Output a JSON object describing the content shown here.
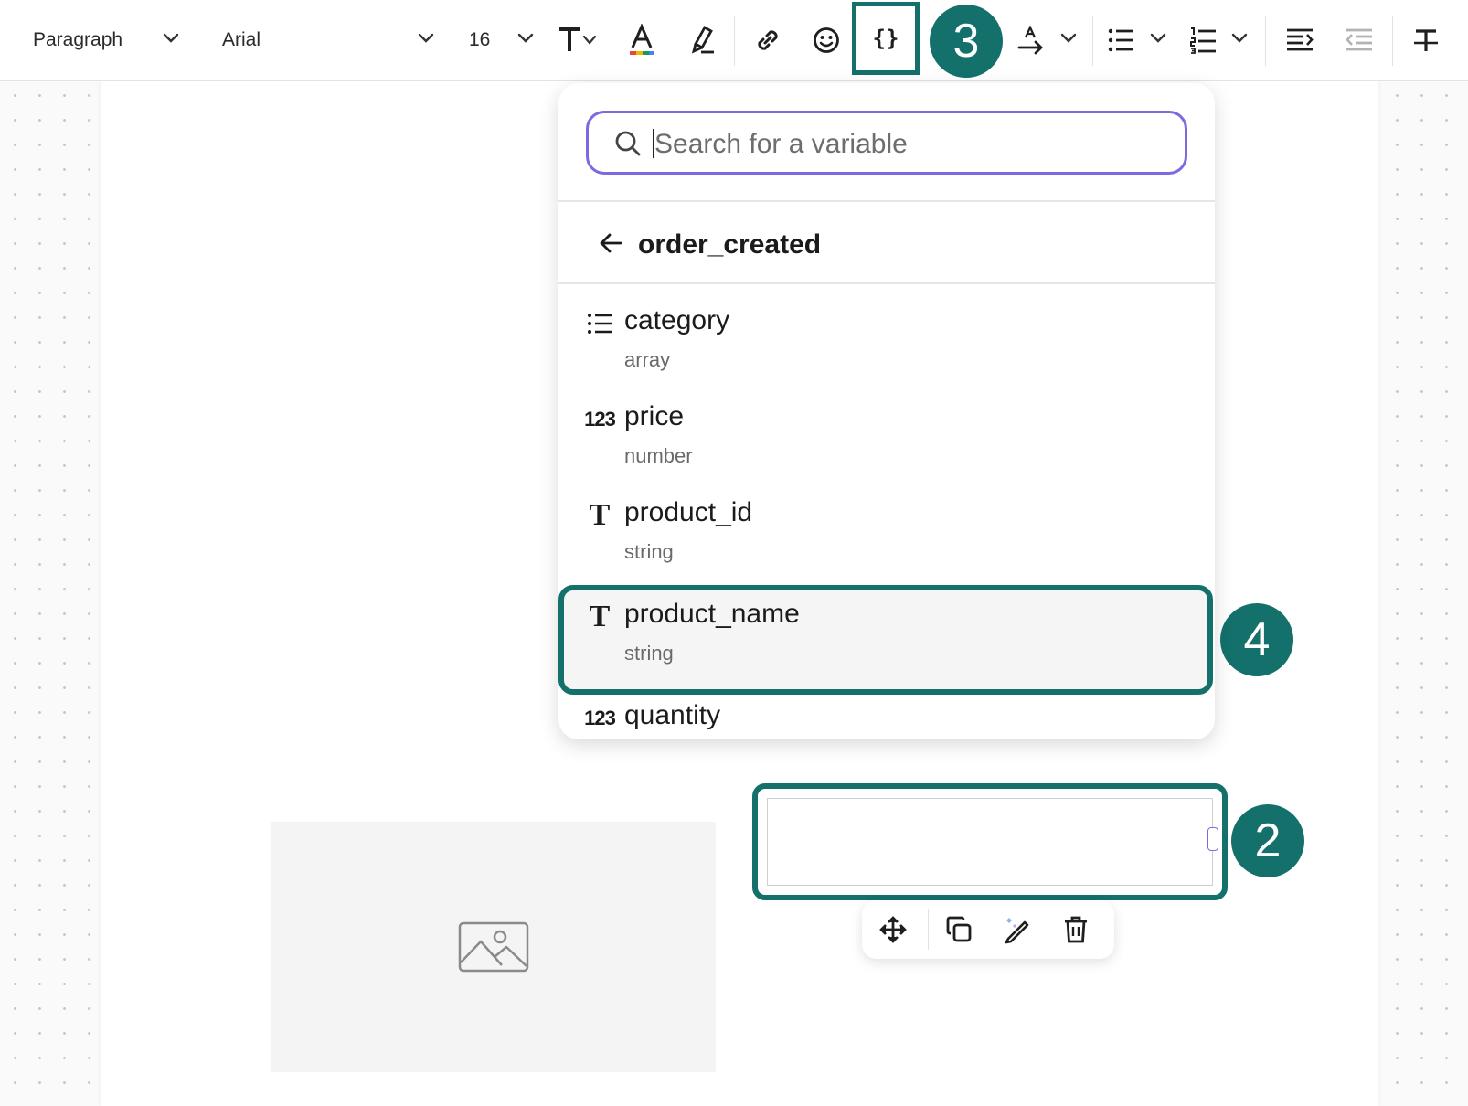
{
  "toolbar": {
    "block_type": "Paragraph",
    "font_family": "Arial",
    "font_size": "16",
    "variable_button": "{}",
    "icons": [
      "text-style-icon",
      "text-color-icon",
      "highlight-icon",
      "link-icon",
      "emoji-icon",
      "variable-braces-icon",
      "text-direction-icon",
      "bullet-list-icon",
      "numbered-list-icon",
      "indent-icon",
      "outdent-icon",
      "clear-format-icon"
    ]
  },
  "callouts": {
    "step_3": "3",
    "step_4": "4",
    "step_2": "2"
  },
  "variable_picker": {
    "search_placeholder": "Search for a variable",
    "group_title": "order_created",
    "items": [
      {
        "name": "category",
        "type": "array",
        "icon": "list-icon"
      },
      {
        "name": "price",
        "type": "number",
        "icon": "number-icon"
      },
      {
        "name": "product_id",
        "type": "string",
        "icon": "text-type-icon"
      },
      {
        "name": "product_name",
        "type": "string",
        "icon": "text-type-icon"
      },
      {
        "name": "quantity",
        "type": "",
        "icon": "number-icon"
      }
    ],
    "number_icon_label": "123",
    "text_icon_label": "T",
    "selected_index": 3
  },
  "block_toolbar": {
    "icons": [
      "move-icon",
      "duplicate-icon",
      "edit-icon",
      "delete-icon"
    ]
  },
  "colors": {
    "accent": "#14706b",
    "focus": "#7b6be0"
  }
}
